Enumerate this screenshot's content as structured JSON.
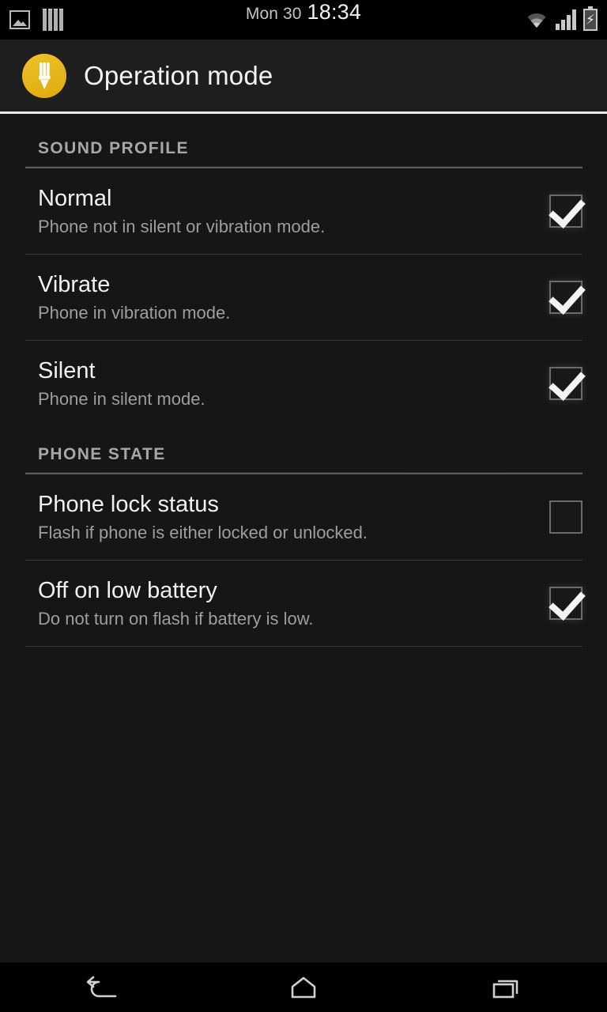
{
  "status_bar": {
    "left_icons": [
      {
        "name": "screenshot-image-icon",
        "label": "image"
      },
      {
        "name": "equalizer-bars-icon",
        "label": "bars"
      }
    ],
    "date": "Mon 30",
    "time": "18:34",
    "right_icons": [
      {
        "name": "wifi-icon",
        "label": "wifi"
      },
      {
        "name": "cellular-signal-icon",
        "label": "signal"
      },
      {
        "name": "battery-charging-icon",
        "label": "battery charging"
      }
    ],
    "battery_glyph": "⚡"
  },
  "action_bar": {
    "app_icon": "flashlight-bulb-icon",
    "title": "Operation mode",
    "accent_color": "#e8b81e"
  },
  "sections": [
    {
      "header": "SOUND PROFILE",
      "rows": [
        {
          "title": "Normal",
          "subtitle": "Phone not in silent or vibration mode.",
          "checked": true,
          "divider_after": true
        },
        {
          "title": "Vibrate",
          "subtitle": "Phone in vibration mode.",
          "checked": true,
          "divider_after": true
        },
        {
          "title": "Silent",
          "subtitle": "Phone in silent mode.",
          "checked": true,
          "divider_after": false
        }
      ]
    },
    {
      "header": "PHONE STATE",
      "rows": [
        {
          "title": "Phone lock status",
          "subtitle": "Flash if phone is either locked or unlocked.",
          "checked": false,
          "divider_after": true
        },
        {
          "title": "Off on low battery",
          "subtitle": "Do not turn on flash if battery is low.",
          "checked": true,
          "divider_after": true
        }
      ]
    }
  ],
  "nav_bar": {
    "buttons": [
      {
        "name": "back-button",
        "label": "Back"
      },
      {
        "name": "home-button",
        "label": "Home"
      },
      {
        "name": "recents-button",
        "label": "Recent apps"
      }
    ]
  },
  "colors": {
    "background": "#141414",
    "action_bar_bg": "#1e1e1e",
    "status_bar_bg": "#000000",
    "title_text": "#f1f1f1",
    "subtitle_text": "#9e9e9e",
    "section_header_text": "#a7a7a7"
  }
}
